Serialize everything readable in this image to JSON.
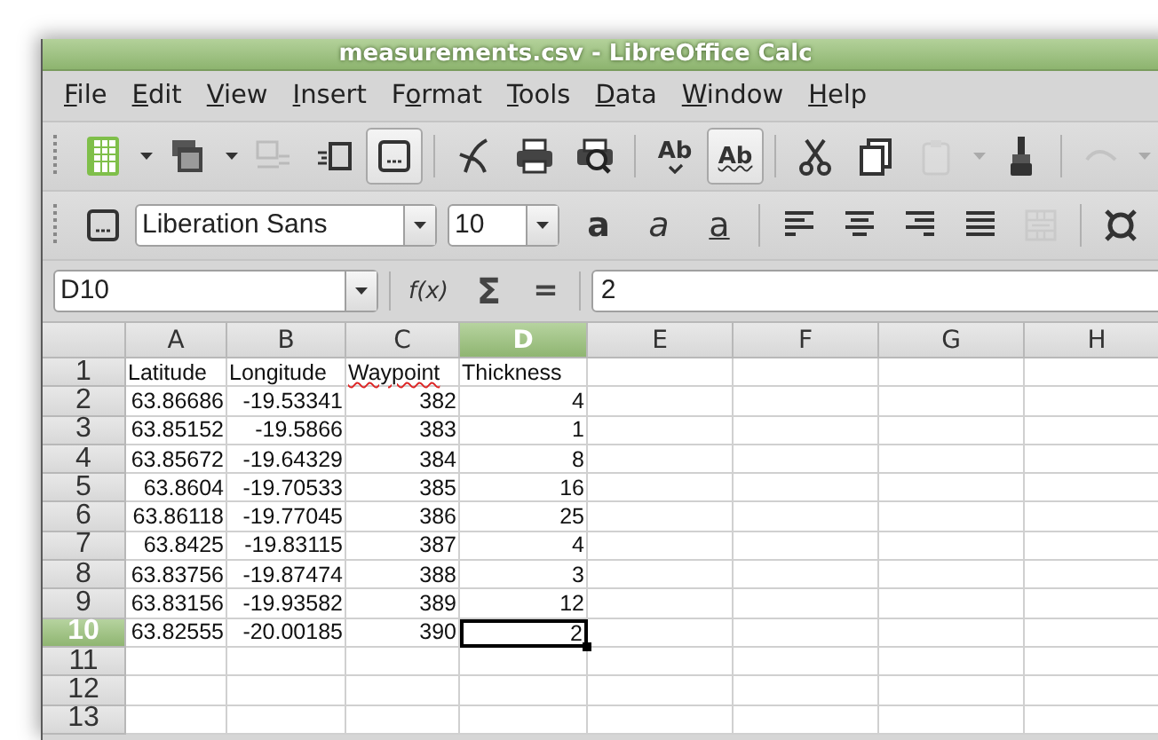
{
  "window": {
    "title": "measurements.csv - LibreOffice Calc"
  },
  "menu": [
    {
      "key": "F",
      "tail": "ile"
    },
    {
      "key": "E",
      "tail": "dit"
    },
    {
      "key": "V",
      "tail": "iew"
    },
    {
      "key": "I",
      "tail": "nsert"
    },
    {
      "lead": "F",
      "key": "o",
      "tail": "rmat"
    },
    {
      "key": "T",
      "tail": "ools"
    },
    {
      "key": "D",
      "tail": "ata"
    },
    {
      "key": "W",
      "tail": "indow"
    },
    {
      "key": "H",
      "tail": "elp"
    }
  ],
  "standard_toolbar": [
    {
      "kind": "spreadsheet",
      "disabled": false,
      "pressed": false,
      "dropdown": true
    },
    {
      "kind": "documents",
      "disabled": false,
      "pressed": false,
      "dropdown": true
    },
    {
      "kind": "window-list",
      "disabled": true,
      "pressed": false,
      "dropdown": false
    },
    {
      "kind": "arrow-box",
      "disabled": false,
      "pressed": false,
      "dropdown": false
    },
    {
      "kind": "dotted-box",
      "disabled": false,
      "pressed": true,
      "dropdown": false
    },
    {
      "kind": "separator"
    },
    {
      "kind": "curve",
      "disabled": false,
      "pressed": false,
      "dropdown": false
    },
    {
      "kind": "printer",
      "disabled": false,
      "pressed": false,
      "dropdown": false
    },
    {
      "kind": "print-preview",
      "disabled": false,
      "pressed": false,
      "dropdown": false
    },
    {
      "kind": "separator"
    },
    {
      "kind": "spellcheck",
      "glyph": "Ab",
      "disabled": false,
      "pressed": false,
      "dropdown": false
    },
    {
      "kind": "autospell",
      "glyph": "Ab",
      "disabled": false,
      "pressed": true,
      "dropdown": false
    },
    {
      "kind": "separator"
    },
    {
      "kind": "scissors",
      "disabled": false,
      "pressed": false,
      "dropdown": false
    },
    {
      "kind": "copy",
      "disabled": false,
      "pressed": false,
      "dropdown": false
    },
    {
      "kind": "paste",
      "disabled": true,
      "pressed": false,
      "dropdown": true
    },
    {
      "kind": "brush",
      "disabled": false,
      "pressed": false,
      "dropdown": false
    },
    {
      "kind": "separator"
    },
    {
      "kind": "undo",
      "disabled": true,
      "pressed": false,
      "dropdown": true
    }
  ],
  "formatting_toolbar": {
    "font_name": "Liberation Sans",
    "font_size": "10",
    "items": [
      {
        "kind": "dotted-box",
        "disabled": false
      },
      {
        "kind": "font-name"
      },
      {
        "kind": "font-size"
      },
      {
        "kind": "bold",
        "glyph": "a",
        "disabled": false
      },
      {
        "kind": "italic",
        "glyph": "a",
        "disabled": false
      },
      {
        "kind": "underline",
        "glyph": "a",
        "disabled": false
      },
      {
        "kind": "separator"
      },
      {
        "kind": "align-left",
        "disabled": false
      },
      {
        "kind": "align-center",
        "disabled": false
      },
      {
        "kind": "align-right",
        "disabled": false
      },
      {
        "kind": "justify",
        "disabled": false
      },
      {
        "kind": "merge",
        "disabled": true
      },
      {
        "kind": "separator"
      },
      {
        "kind": "currency",
        "disabled": false
      }
    ]
  },
  "formula_bar": {
    "name_box": "D10",
    "function_wizard": "f(x)",
    "sum": "Σ",
    "equals": "=",
    "value": "2"
  },
  "sheet": {
    "columns": [
      {
        "label": "A",
        "selected": false
      },
      {
        "label": "B",
        "selected": false
      },
      {
        "label": "C",
        "selected": false
      },
      {
        "label": "D",
        "selected": true
      },
      {
        "label": "E",
        "selected": false
      },
      {
        "label": "F",
        "selected": false
      },
      {
        "label": "G",
        "selected": false
      },
      {
        "label": "H",
        "selected": false
      }
    ],
    "rows": [
      {
        "header": "1",
        "selected": false,
        "kind": "text",
        "cells": [
          {
            "text": "Latitude",
            "misspelled": false
          },
          {
            "text": "Longitude",
            "misspelled": false
          },
          {
            "text": "Waypoint",
            "misspelled": true
          },
          {
            "text": "Thickness",
            "misspelled": false
          }
        ]
      },
      {
        "header": "2",
        "selected": false,
        "kind": "number",
        "cells": [
          {
            "text": "63.86686"
          },
          {
            "text": "-19.53341"
          },
          {
            "text": "382"
          },
          {
            "text": "4"
          }
        ]
      },
      {
        "header": "3",
        "selected": false,
        "kind": "number",
        "cells": [
          {
            "text": "63.85152"
          },
          {
            "text": "-19.5866"
          },
          {
            "text": "383"
          },
          {
            "text": "1"
          }
        ]
      },
      {
        "header": "4",
        "selected": false,
        "kind": "number",
        "cells": [
          {
            "text": "63.85672"
          },
          {
            "text": "-19.64329"
          },
          {
            "text": "384"
          },
          {
            "text": "8"
          }
        ]
      },
      {
        "header": "5",
        "selected": false,
        "kind": "number",
        "cells": [
          {
            "text": "63.8604"
          },
          {
            "text": "-19.70533"
          },
          {
            "text": "385"
          },
          {
            "text": "16"
          }
        ]
      },
      {
        "header": "6",
        "selected": false,
        "kind": "number",
        "cells": [
          {
            "text": "63.86118"
          },
          {
            "text": "-19.77045"
          },
          {
            "text": "386"
          },
          {
            "text": "25"
          }
        ]
      },
      {
        "header": "7",
        "selected": false,
        "kind": "number",
        "cells": [
          {
            "text": "63.8425"
          },
          {
            "text": "-19.83115"
          },
          {
            "text": "387"
          },
          {
            "text": "4"
          }
        ]
      },
      {
        "header": "8",
        "selected": false,
        "kind": "number",
        "cells": [
          {
            "text": "63.83756"
          },
          {
            "text": "-19.87474"
          },
          {
            "text": "388"
          },
          {
            "text": "3"
          }
        ]
      },
      {
        "header": "9",
        "selected": false,
        "kind": "number",
        "cells": [
          {
            "text": "63.83156"
          },
          {
            "text": "-19.93582"
          },
          {
            "text": "389"
          },
          {
            "text": "12"
          }
        ]
      },
      {
        "header": "10",
        "selected": true,
        "kind": "number",
        "cells": [
          {
            "text": "63.82555"
          },
          {
            "text": "-20.00185"
          },
          {
            "text": "390"
          },
          {
            "text": "2"
          }
        ]
      },
      {
        "header": "11",
        "selected": false,
        "kind": "number",
        "cells": []
      },
      {
        "header": "12",
        "selected": false,
        "kind": "number",
        "cells": []
      },
      {
        "header": "13",
        "selected": false,
        "kind": "number",
        "cells": []
      }
    ]
  }
}
